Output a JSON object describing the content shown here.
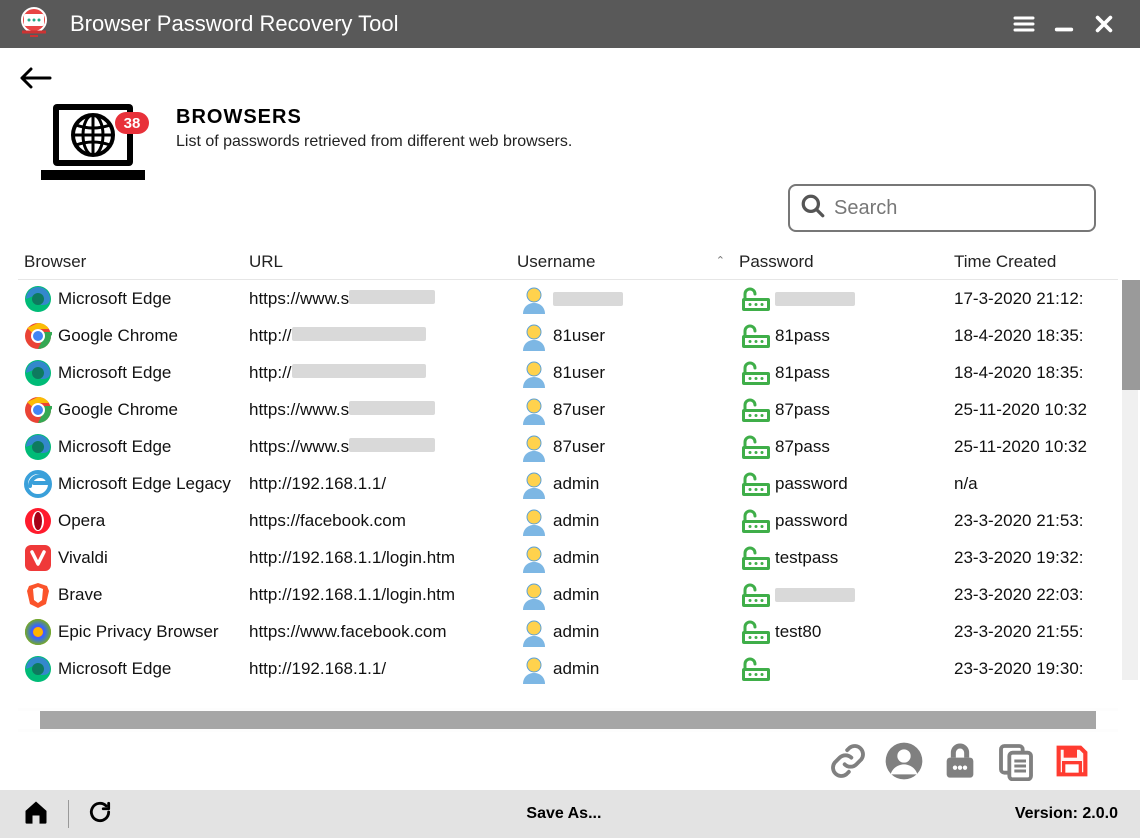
{
  "app": {
    "title": "Browser Password Recovery Tool"
  },
  "badge_count": "38",
  "header": {
    "title": "BROWSERS",
    "subtitle": "List of passwords retrieved from different web browsers."
  },
  "search": {
    "placeholder": "Search"
  },
  "columns": {
    "browser": "Browser",
    "url": "URL",
    "username": "Username",
    "password": "Password",
    "time": "Time Created"
  },
  "rows": [
    {
      "browser": "Microsoft Edge",
      "icon": "edge",
      "url_prefix": "https://www.s",
      "url_blur": true,
      "user": "",
      "user_blur": true,
      "pass": "",
      "pass_blur": true,
      "time": "17-3-2020 21:12:"
    },
    {
      "browser": "Google Chrome",
      "icon": "chrome",
      "url_prefix": "http://",
      "url_blur": true,
      "user": "81user",
      "user_blur": false,
      "pass": "81pass",
      "pass_blur": false,
      "time": "18-4-2020 18:35:"
    },
    {
      "browser": "Microsoft Edge",
      "icon": "edge",
      "url_prefix": "http://",
      "url_blur": true,
      "user": "81user",
      "user_blur": false,
      "pass": "81pass",
      "pass_blur": false,
      "time": "18-4-2020 18:35:"
    },
    {
      "browser": "Google Chrome",
      "icon": "chrome",
      "url_prefix": "https://www.s",
      "url_blur": true,
      "user": "87user",
      "user_blur": false,
      "pass": "87pass",
      "pass_blur": false,
      "time": "25-11-2020 10:32"
    },
    {
      "browser": "Microsoft Edge",
      "icon": "edge",
      "url_prefix": "https://www.s",
      "url_blur": true,
      "user": "87user",
      "user_blur": false,
      "pass": "87pass",
      "pass_blur": false,
      "time": "25-11-2020 10:32"
    },
    {
      "browser": "Microsoft Edge Legacy",
      "icon": "edge-legacy",
      "url_prefix": "http://192.168.1.1/",
      "url_blur": false,
      "user": "admin",
      "user_blur": false,
      "pass": "password",
      "pass_blur": false,
      "time": "n/a"
    },
    {
      "browser": "Opera",
      "icon": "opera",
      "url_prefix": "https://facebook.com",
      "url_blur": false,
      "user": "admin",
      "user_blur": false,
      "pass": "password",
      "pass_blur": false,
      "time": "23-3-2020 21:53:"
    },
    {
      "browser": "Vivaldi",
      "icon": "vivaldi",
      "url_prefix": "http://192.168.1.1/login.htm",
      "url_blur": false,
      "user": "admin",
      "user_blur": false,
      "pass": "testpass",
      "pass_blur": false,
      "time": "23-3-2020 19:32:"
    },
    {
      "browser": "Brave",
      "icon": "brave",
      "url_prefix": "http://192.168.1.1/login.htm",
      "url_blur": false,
      "user": "admin",
      "user_blur": false,
      "pass": "",
      "pass_blur": true,
      "time": "23-3-2020 22:03:"
    },
    {
      "browser": "Epic Privacy Browser",
      "icon": "epic",
      "url_prefix": "https://www.facebook.com",
      "url_blur": false,
      "user": "admin",
      "user_blur": false,
      "pass": "test80",
      "pass_blur": false,
      "time": "23-3-2020 21:55:"
    },
    {
      "browser": "Microsoft Edge",
      "icon": "edge",
      "url_prefix": "http://192.168.1.1/",
      "url_blur": false,
      "user": "admin",
      "user_blur": false,
      "pass": "",
      "pass_blur": false,
      "time": "23-3-2020 19:30:"
    }
  ],
  "statusbar": {
    "center": "Save As...",
    "version_label": "Version:",
    "version": "2.0.0"
  }
}
